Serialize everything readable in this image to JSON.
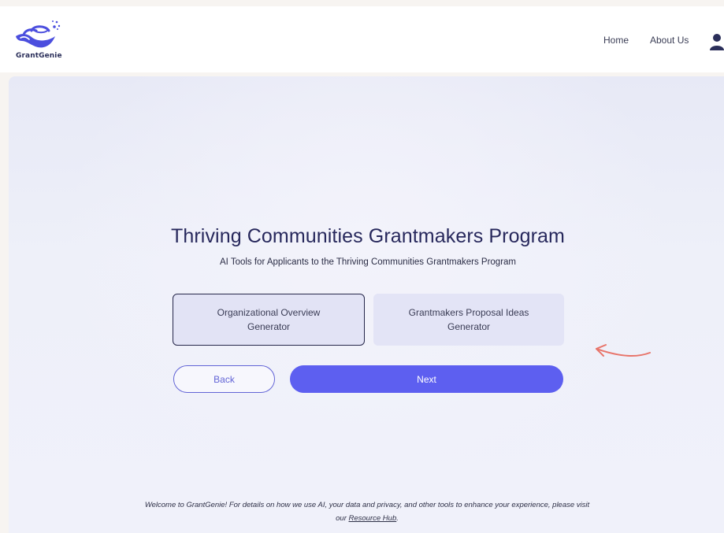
{
  "header": {
    "logo_text": "GrantGenie",
    "nav": {
      "home": "Home",
      "about": "About Us"
    }
  },
  "main": {
    "title": "Thriving Communities Grantmakers Program",
    "subtitle": "AI Tools for Applicants to the Thriving Communities Grantmakers Program",
    "options": [
      {
        "label": "Organizational Overview Generator",
        "selected": true
      },
      {
        "label": "Grantmakers Proposal Ideas Generator",
        "selected": false
      }
    ],
    "back_label": "Back",
    "next_label": "Next"
  },
  "footer": {
    "text_before_link": "Welcome to GrantGenie! For details on how we use AI, your data and privacy, and other tools to enhance your experience, please visit our ",
    "link_text": "Resource Hub",
    "text_after_link": "."
  },
  "colors": {
    "accent": "#5d5ff0",
    "title": "#27285c",
    "annotation_arrow": "#e8746a"
  },
  "icons": {
    "logo": "genie-lamp-icon",
    "user": "user-icon",
    "annotation": "curved-arrow-icon"
  }
}
